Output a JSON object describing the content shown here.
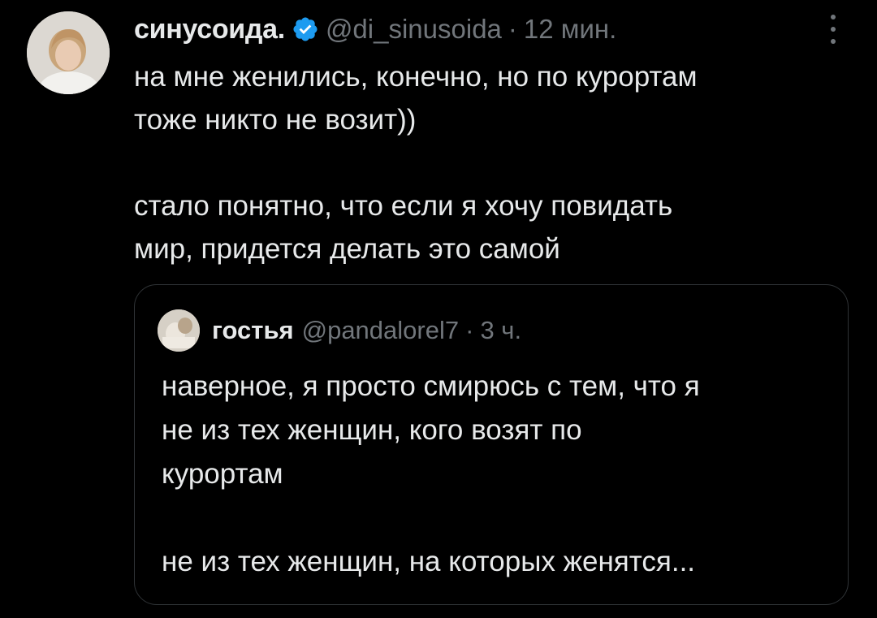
{
  "tweet": {
    "author_name": "синусоида.",
    "author_handle": "@di_sinusoida",
    "separator": "·",
    "time": "12 мин.",
    "paragraph_1_line_1": "на мне женились, конечно, но по курортам",
    "paragraph_1_line_2": "тоже никто не возит))",
    "paragraph_2_line_1": "стало понятно, что если я хочу повидать",
    "paragraph_2_line_2": "мир, придется делать это самой"
  },
  "quote": {
    "author_name": "гостья",
    "author_handle": "@pandalorel7",
    "separator": "·",
    "time": "3 ч.",
    "line_1": "наверное, я просто смирюсь с тем, что я",
    "line_2": "не из тех женщин, кого возят по",
    "line_3": "курортам",
    "line_4": "не из тех женщин, на которых женятся..."
  },
  "colors": {
    "background": "#000000",
    "text_primary": "#e7e9ea",
    "text_secondary": "#71767b",
    "verified_badge": "#1d9bf0",
    "quote_border": "#2f3336"
  },
  "icons": {
    "verified": "verified-badge-icon",
    "more": "more-vertical-icon"
  }
}
